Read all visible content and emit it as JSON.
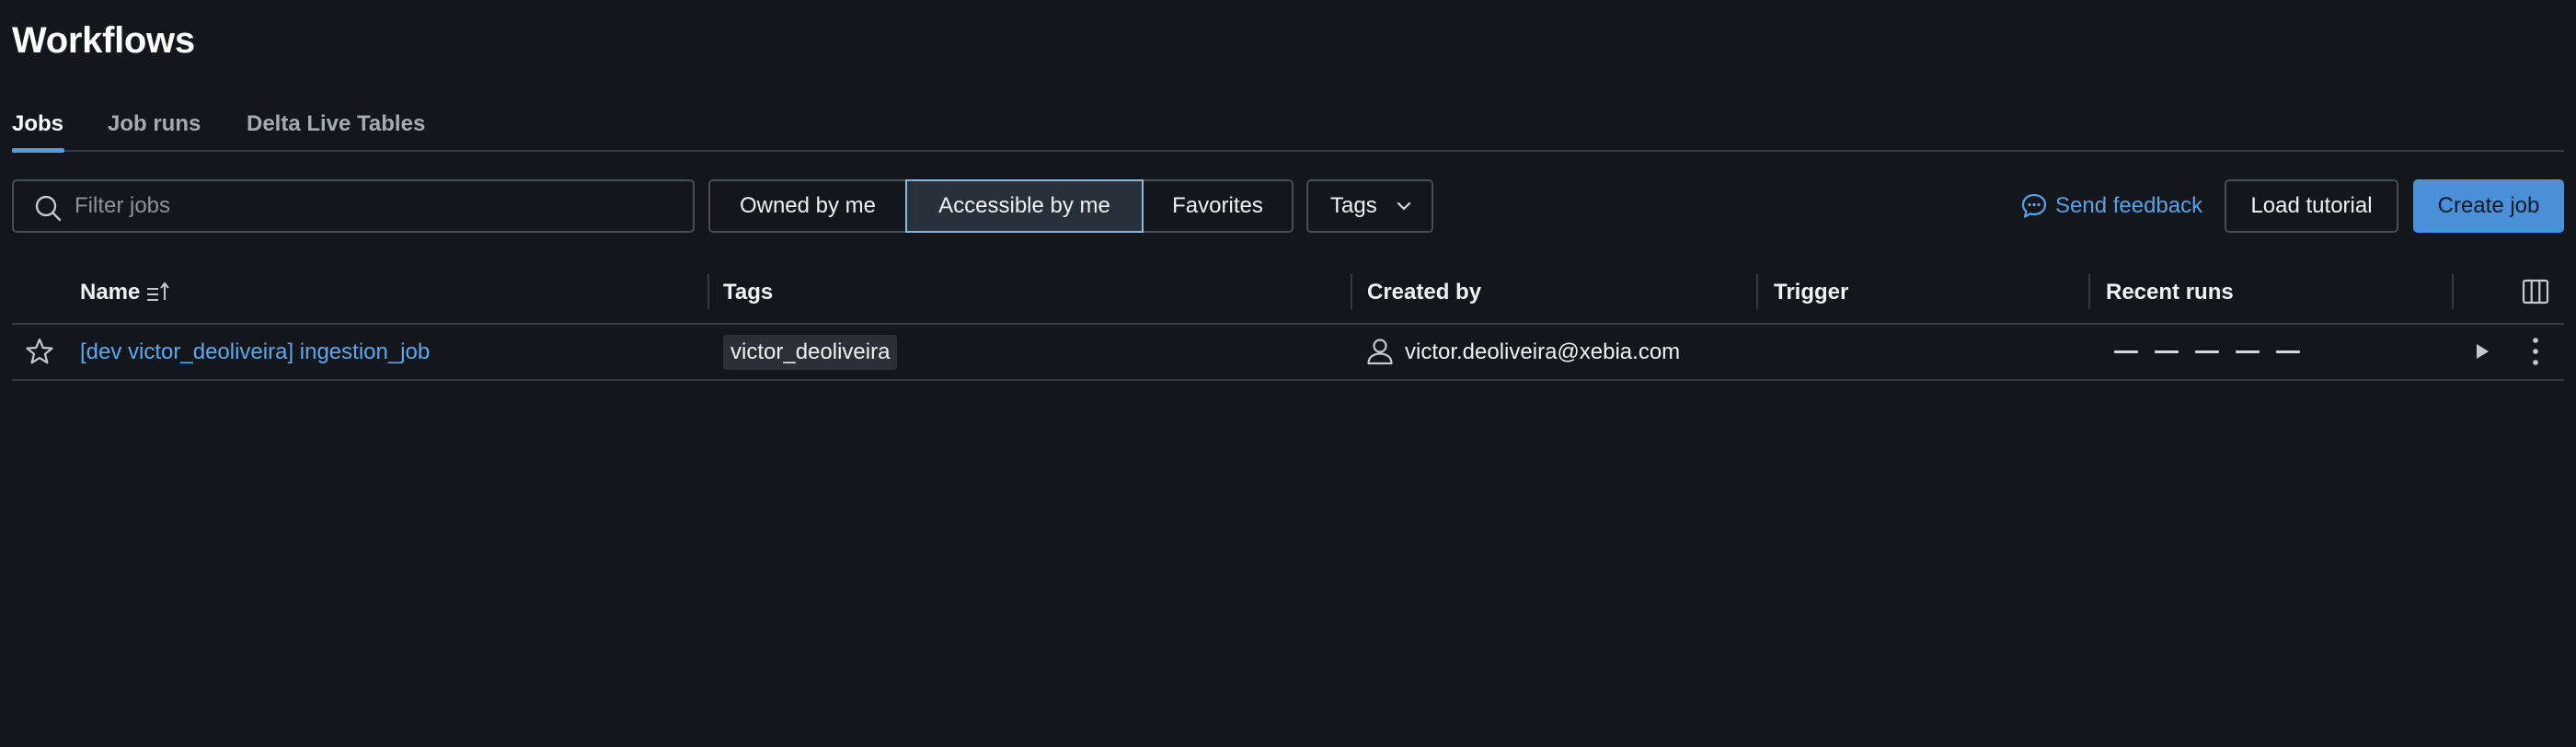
{
  "page": {
    "title": "Workflows"
  },
  "tabs": [
    {
      "label": "Jobs",
      "active": true
    },
    {
      "label": "Job runs",
      "active": false
    },
    {
      "label": "Delta Live Tables",
      "active": false
    }
  ],
  "toolbar": {
    "search_placeholder": "Filter jobs",
    "search_value": "",
    "filters": [
      {
        "label": "Owned by me",
        "selected": false
      },
      {
        "label": "Accessible by me",
        "selected": true
      },
      {
        "label": "Favorites",
        "selected": false
      }
    ],
    "tags_label": "Tags",
    "feedback_label": "Send feedback",
    "load_tutorial_label": "Load tutorial",
    "create_job_label": "Create job"
  },
  "table": {
    "columns": [
      "Name",
      "Tags",
      "Created by",
      "Trigger",
      "Recent runs"
    ],
    "rows": [
      {
        "name": "[dev victor_deoliveira] ingestion_job",
        "tag": "victor_deoliveira",
        "created_by": "victor.deoliveira@xebia.com",
        "trigger": "",
        "recent_runs": [
          "—",
          "—",
          "—",
          "—",
          "—"
        ]
      }
    ]
  },
  "colors": {
    "background": "#13171b",
    "accent": "#4a90d9",
    "link": "#5ba8ef",
    "border": "#474f57"
  },
  "icons": {
    "search": "search-icon",
    "sort": "sort-ascending-icon",
    "feedback": "chat-bubble-icon",
    "chevron": "chevron-down-icon",
    "columns": "columns-icon",
    "star": "star-outline-icon",
    "user": "user-icon",
    "run": "play-icon",
    "more": "kebab-menu-icon"
  }
}
